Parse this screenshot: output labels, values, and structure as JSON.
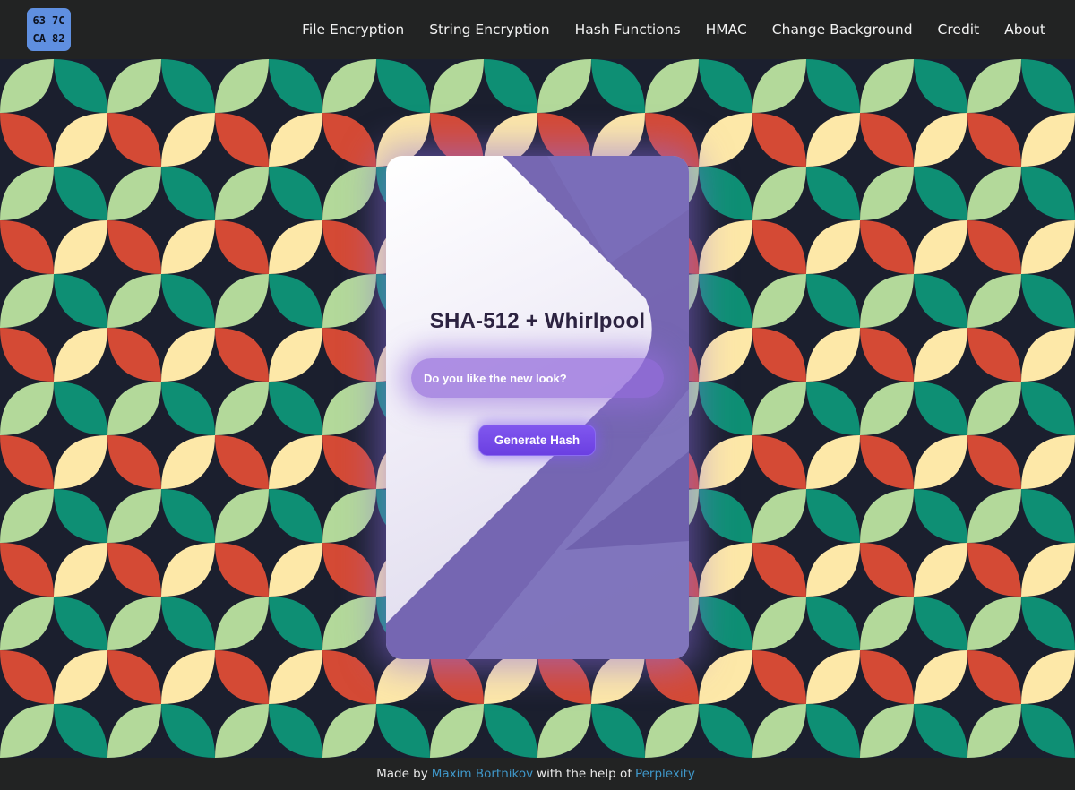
{
  "header": {
    "logo": {
      "cells": [
        "63",
        "7C",
        "CA",
        "82"
      ],
      "color": "#5f8fe0"
    },
    "nav": [
      {
        "label": "File Encryption"
      },
      {
        "label": "String Encryption"
      },
      {
        "label": "Hash Functions"
      },
      {
        "label": "HMAC"
      },
      {
        "label": "Change Background"
      },
      {
        "label": "Credit"
      },
      {
        "label": "About"
      }
    ]
  },
  "background": {
    "colors": {
      "base": "#1b1f2e",
      "green": "#0e8f74",
      "lightgreen": "#b3d99a",
      "red": "#d44a35",
      "yellow": "#fde8a8"
    }
  },
  "card": {
    "title": "SHA-512 + Whirlpool",
    "input": {
      "placeholder": "Do you like the new look?",
      "value": ""
    },
    "button": "Generate Hash",
    "accent": "#6f5fae"
  },
  "footer": {
    "prefix": "Made by",
    "author": "Maxim Bortnikov",
    "middle": "with the help of",
    "tool": "Perplexity",
    "link_color": "#3f97c9"
  }
}
